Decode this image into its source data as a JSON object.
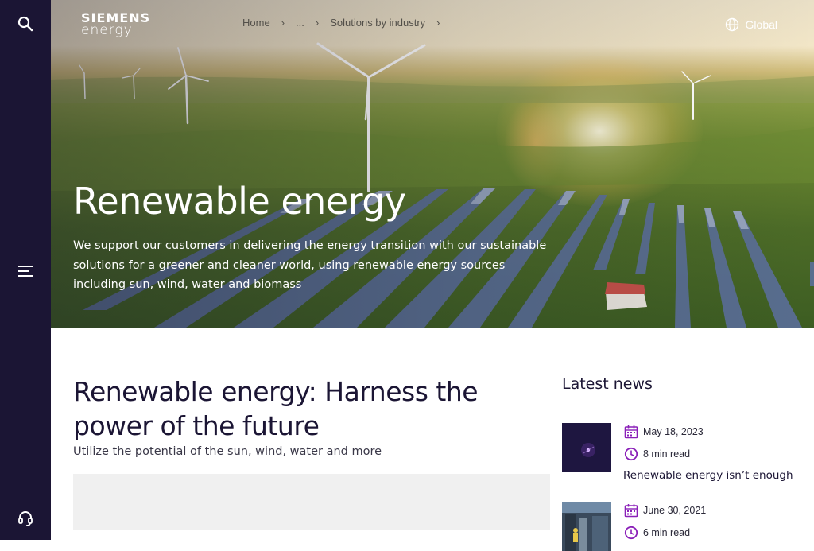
{
  "brand": {
    "line1": "SIEMENS",
    "line2": "energy"
  },
  "breadcrumb": [
    {
      "label": "Home"
    },
    {
      "label": "..."
    },
    {
      "label": "Solutions by industry"
    }
  ],
  "region": {
    "label": "Global"
  },
  "hero": {
    "title": "Renewable energy",
    "description": "We support our customers in delivering the energy transition with our sustainable solutions for a greener and cleaner world, using renewable energy sources including sun, wind, water and biomass"
  },
  "main": {
    "title": "Renewable energy: Harness the power of the future",
    "subtitle": "Utilize the potential of the sun, wind, water and more"
  },
  "news": {
    "heading": "Latest news",
    "items": [
      {
        "date": "May 18, 2023",
        "read_time": "8 min read",
        "title": "Renewable energy isn’t enough"
      },
      {
        "date": "June 30, 2021",
        "read_time": "6 min read",
        "title": ""
      }
    ]
  },
  "icons": {
    "search": "search-icon",
    "menu": "menu-icon",
    "support": "headset-icon",
    "globe": "globe-icon",
    "calendar": "calendar-icon",
    "clock": "clock-icon"
  },
  "colors": {
    "sidebar": "#1b1534",
    "accent": "#8a1fb8",
    "title_text": "#1b1534"
  }
}
